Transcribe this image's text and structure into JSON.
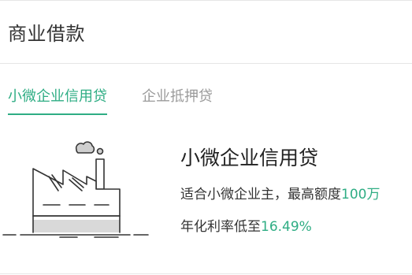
{
  "header": {
    "title": "商业借款"
  },
  "tabs": [
    {
      "label": "小微企业信用贷",
      "active": true
    },
    {
      "label": "企业抵押贷",
      "active": false
    }
  ],
  "product": {
    "title": "小微企业信用贷",
    "desc1_prefix": "适合小微企业主，最高额度",
    "desc1_amount": "100万",
    "desc2_prefix": "年化利率低至",
    "desc2_rate": "16.49%"
  },
  "icons": {
    "illustration": "factory-illustration"
  },
  "colors": {
    "accent": "#2fad84",
    "inactive_tab": "#9b9b9b",
    "text": "#333333"
  }
}
